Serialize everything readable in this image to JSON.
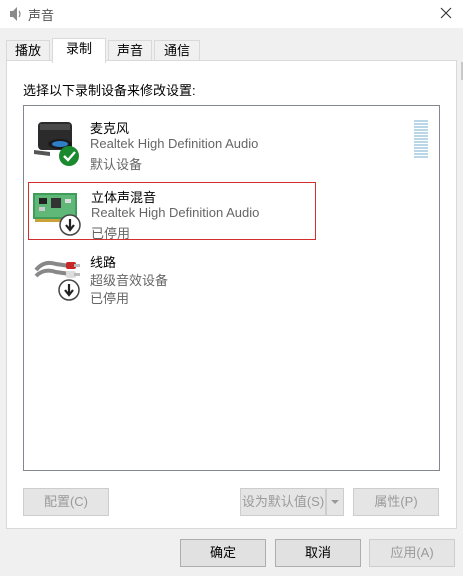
{
  "window": {
    "title": "声音",
    "icon": "speaker-icon"
  },
  "tabs": [
    {
      "label": "播放",
      "active": false
    },
    {
      "label": "录制",
      "active": true
    },
    {
      "label": "声音",
      "active": false
    },
    {
      "label": "通信",
      "active": false
    }
  ],
  "pane": {
    "instruction": "选择以下录制设备来修改设置:",
    "devices": [
      {
        "name": "麦克风",
        "description": "Realtek High Definition Audio",
        "status": "默认设备",
        "icon": "microphone-icon",
        "badge": "default-check-icon"
      },
      {
        "name": "立体声混音",
        "description": "Realtek High Definition Audio",
        "status": "已停用",
        "icon": "sound-card-icon",
        "badge": "disabled-arrow-icon",
        "selected": true
      },
      {
        "name": "线路",
        "description": "超级音效设备",
        "status": "已停用",
        "icon": "line-in-cable-icon",
        "badge": "disabled-arrow-icon"
      }
    ],
    "buttons": {
      "configure": "配置(C)",
      "set_default": "设为默认值(S)",
      "properties": "属性(P)"
    }
  },
  "dialog_buttons": {
    "ok": "确定",
    "cancel": "取消",
    "apply": "应用(A)"
  },
  "colors": {
    "selection_border": "#d32f2f",
    "default_check": "#1b8a2e",
    "level_meter": "#b9d7e6"
  }
}
